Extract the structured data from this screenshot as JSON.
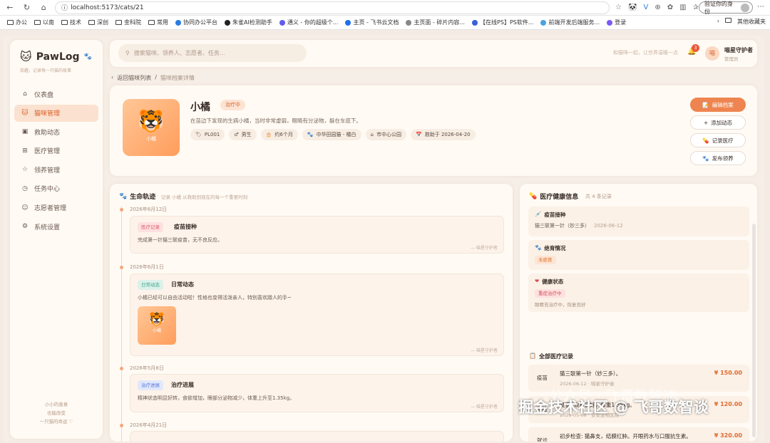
{
  "browser": {
    "url": "localhost:5173/cats/21",
    "identity_label": "验证你的身份",
    "bookmarks": [
      "办公",
      "以南",
      "技术",
      "深创",
      "金科院",
      "常用",
      "协同办公平台",
      "朱雀AI检测助手",
      "通义 - 你的超级个...",
      "主页 - 飞书云文档",
      "主页面 - 碎片内容...",
      "【在线PS】PS软件...",
      "前端开发后端服务...",
      "登录"
    ],
    "other_bookmarks": "其他收藏夹"
  },
  "brand": {
    "name": "PawLog",
    "tagline": "拾趣，记录每一只猫的故事"
  },
  "menu": [
    {
      "label": "仪表盘",
      "icon": "home-icon",
      "active": false
    },
    {
      "label": "猫咪管理",
      "icon": "cat-icon",
      "active": true
    },
    {
      "label": "救助动态",
      "icon": "news-icon",
      "active": false
    },
    {
      "label": "医疗管理",
      "icon": "medical-icon",
      "active": false
    },
    {
      "label": "领养管理",
      "icon": "star-icon",
      "active": false
    },
    {
      "label": "任务中心",
      "icon": "clock-icon",
      "active": false
    },
    {
      "label": "志愿者管理",
      "icon": "user-icon",
      "active": false
    },
    {
      "label": "系统设置",
      "icon": "gear-icon",
      "active": false
    }
  ],
  "sidebar_footer": [
    "小小的善意",
    "也能改变",
    "一只猫的命运 ♡"
  ],
  "header": {
    "search_placeholder": "搜索猫咪、领养人、志愿者、任务...",
    "hint": "和猫咪一起，让世界温暖一点",
    "notification_count": "3",
    "user_name": "喵星守护者",
    "user_role": "管理员",
    "avatar_text": "喵"
  },
  "breadcrumb": {
    "back": "返回猫咪列表",
    "current": "猫咪档案详情"
  },
  "cat": {
    "name": "小橘",
    "status": "治疗中",
    "description": "在苗边下发现的生病小橘，当时非常虚弱，眼睛有分泌物，躲在车底下。",
    "chips": [
      {
        "icon": "🏷",
        "text": "PL001"
      },
      {
        "icon": "♂",
        "text": "男生"
      },
      {
        "icon": "🎂",
        "text": "约6个月"
      },
      {
        "icon": "🐾",
        "text": "中华田园猫 - 橘白"
      },
      {
        "icon": "⌂",
        "text": "市中心公园"
      },
      {
        "icon": "📅",
        "text": "救助于 2026-04-20"
      }
    ]
  },
  "actions": [
    {
      "icon": "📝",
      "label": "编辑档案",
      "primary": true
    },
    {
      "icon": "+",
      "label": "添加动态",
      "primary": false
    },
    {
      "icon": "💊",
      "label": "记录医疗",
      "primary": false
    },
    {
      "icon": "🐾",
      "label": "发布领养",
      "primary": false
    }
  ],
  "timeline": {
    "title": "生命轨迹",
    "subtitle": "记录 小橘 从救助到现在的每一个重要时刻",
    "events": [
      {
        "date": "2026年6月12日",
        "tag": "医疗记录",
        "tag_type": "med",
        "title": "疫苗接种",
        "text": "完成第一针猫三联疫苗，无不良反应。",
        "author": "— 喵星守护者"
      },
      {
        "date": "2026年6月1日",
        "tag": "日常动态",
        "tag_type": "daily",
        "title": "日常动态",
        "text": "小橘已经可以自由活动啦！性格也变得活泼亲人，特别喜欢蹭人的手~",
        "author": "— 喵星守护者",
        "image_caption": "小橘"
      },
      {
        "date": "2026年5月8日",
        "tag": "治疗进展",
        "tag_type": "prog",
        "title": "治疗进展",
        "text": "精神状态明显好转，食欲增加，眼部分泌物减少，体重上升至1.35kg。",
        "author": "— 喵星守护者"
      },
      {
        "date": "2026年4月21日"
      }
    ]
  },
  "health": {
    "title": "医疗健康信息",
    "count": "共 4 条记录",
    "vaccine": {
      "title": "疫苗接种",
      "text": "猫三联第一针（妙三多）",
      "date": "2026-06-12"
    },
    "neuter": {
      "title": "绝育情况",
      "status": "未绝育"
    },
    "condition": {
      "title": "健康状态",
      "status": "重症治疗中",
      "note": "眼睛充治疗中，恢复良好"
    },
    "all_title": "全部医疗记录",
    "records": [
      {
        "type": "疫苗",
        "desc": "猫三联第一针（妙三多）。",
        "date": "2026-06-12 · 喵星守护者",
        "amount": "¥ 150.00"
      },
      {
        "type": "体检",
        "desc": "复查: 恢复良好，体重1.35kg。",
        "date": "2026-05-08 · 安安宠物医院",
        "amount": "¥ 120.00"
      },
      {
        "type": "就诊",
        "desc": "初步检查: 猫鼻支，结膜红肿。开眼药水与口服抗生素。",
        "date": "2026-04-21 · 安安宠物医院",
        "amount": "¥ 320.00"
      }
    ]
  },
  "watermark": {
    "line1": "公众号 · 飞哥数智谈",
    "line2": "掘金技术社区 @ 飞哥数智谈"
  }
}
